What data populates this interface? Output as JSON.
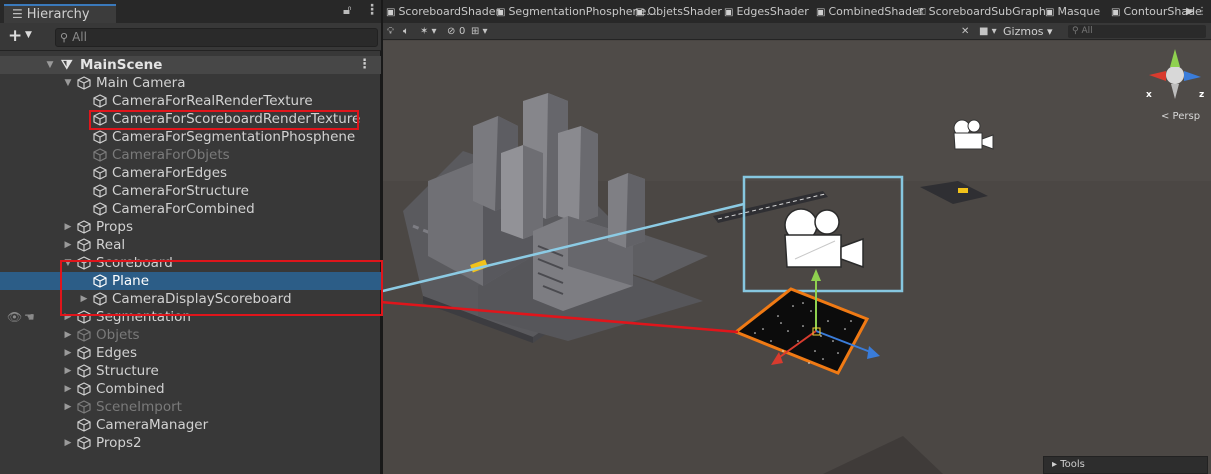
{
  "hierarchy": {
    "tab_label": "Hierarchy",
    "tab_icon": "list-icon",
    "lock_icon": "lock-icon",
    "menu_icon": "kebab-menu-icon",
    "add_label": "+",
    "search_placeholder": "All",
    "scene_name": "MainScene",
    "items": [
      {
        "label": "Main Camera"
      },
      {
        "label": "CameraForRealRenderTexture"
      },
      {
        "label": "CameraForScoreboardRenderTexture"
      },
      {
        "label": "CameraForSegmentationPhosphene"
      },
      {
        "label": "CameraForObjets"
      },
      {
        "label": "CameraForEdges"
      },
      {
        "label": "CameraForStructure"
      },
      {
        "label": "CameraForCombined"
      },
      {
        "label": "Props"
      },
      {
        "label": "Real"
      },
      {
        "label": "Scoreboard"
      },
      {
        "label": "Plane"
      },
      {
        "label": "CameraDisplayScoreboard"
      },
      {
        "label": "Segmentation"
      },
      {
        "label": "Objets"
      },
      {
        "label": "Edges"
      },
      {
        "label": "Structure"
      },
      {
        "label": "Combined"
      },
      {
        "label": "SceneImport"
      },
      {
        "label": "CameraManager"
      },
      {
        "label": "Props2"
      }
    ]
  },
  "scene": {
    "shader_tabs": [
      {
        "label": "ScoreboardShader",
        "icon": "shader-icon"
      },
      {
        "label": "SegmentationPhosphene...",
        "icon": "shader-icon"
      },
      {
        "label": "ObjetsShader",
        "icon": "shader-icon"
      },
      {
        "label": "EdgesShader",
        "icon": "shader-icon"
      },
      {
        "label": "CombinedShader",
        "icon": "shader-icon"
      },
      {
        "label": "ScoreboardSubGraph",
        "icon": "subgraph-icon"
      },
      {
        "label": "Masque",
        "icon": "shader-icon"
      },
      {
        "label": "ContourShade",
        "icon": "shader-icon"
      }
    ],
    "toolbar": {
      "hidden_count": "0",
      "gizmos_label": "Gizmos",
      "search_placeholder": "All"
    },
    "persp_label": "< Persp",
    "axis_x": "x",
    "axis_z": "z",
    "tools_label": "Tools"
  },
  "colors": {
    "selection": "#2c5d87",
    "highlight_box": "#e0151b",
    "callout_box": "#86c7e0",
    "callout_line": "#8ccbe4",
    "plane_outline": "#f07a14"
  }
}
